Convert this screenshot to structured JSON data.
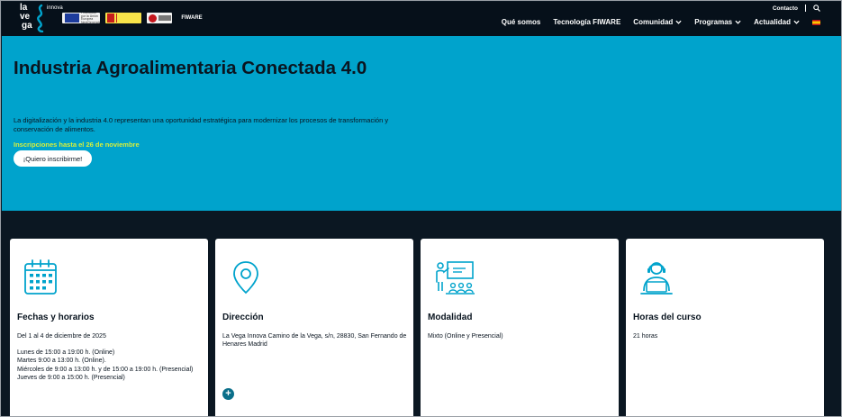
{
  "header": {
    "logo": {
      "line1": "la",
      "line2": "ve",
      "line3": "ga",
      "side": "innova"
    },
    "sponsors": [
      {
        "name": "eu-logo",
        "text": "Financiado por la Unión Europea NextGenerationEU"
      },
      {
        "name": "gobierno-logo"
      },
      {
        "name": "red-logo"
      },
      {
        "name": "fiware-logo",
        "text": "FIWARE"
      }
    ],
    "contact_label": "Contacto",
    "nav": [
      {
        "label": "Qué somos",
        "dropdown": false
      },
      {
        "label": "Tecnología FIWARE",
        "dropdown": false
      },
      {
        "label": "Comunidad",
        "dropdown": true
      },
      {
        "label": "Programas",
        "dropdown": true
      },
      {
        "label": "Actualidad",
        "dropdown": true
      }
    ]
  },
  "hero": {
    "title": "Industria Agroalimentaria Conectada 4.0",
    "description": "La digitalización y la industria 4.0 representan una oportunidad estratégica para modernizar los procesos de transformación y conservación de alimentos.",
    "deadline": "Inscripciones hasta el 26 de noviembre",
    "cta_label": "¡Quiero inscribirme!"
  },
  "cards": [
    {
      "icon": "calendar-icon",
      "title": "Fechas y horarios",
      "lines": [
        "Del 1 al 4 de diciembre de 2025",
        "",
        "Lunes de 15:00 a 19:00 h. (Online)",
        "Martes 9:00 a 13:00 h. (Online).",
        "Miércoles de 9:00 a 13:00 h. y de 15:00 a 19:00 h. (Presencial)",
        "Jueves de 9:00 a 15:00 h. (Presencial)"
      ]
    },
    {
      "icon": "location-pin-icon",
      "title": "Dirección",
      "lines": [
        "La Vega Innova Camino de la Vega, s/n, 28830, San Fernando de Henares Madrid"
      ]
    },
    {
      "icon": "presentation-icon",
      "title": "Modalidad",
      "lines": [
        "Mixto (Online y Presencial)"
      ]
    },
    {
      "icon": "student-laptop-icon",
      "title": "Horas del curso",
      "lines": [
        "21 horas"
      ]
    }
  ],
  "colors": {
    "hero_bg": "#00a3cc",
    "header_bg": "#06101a",
    "deadline": "#d8ef3a",
    "icon": "#00a3cc"
  }
}
